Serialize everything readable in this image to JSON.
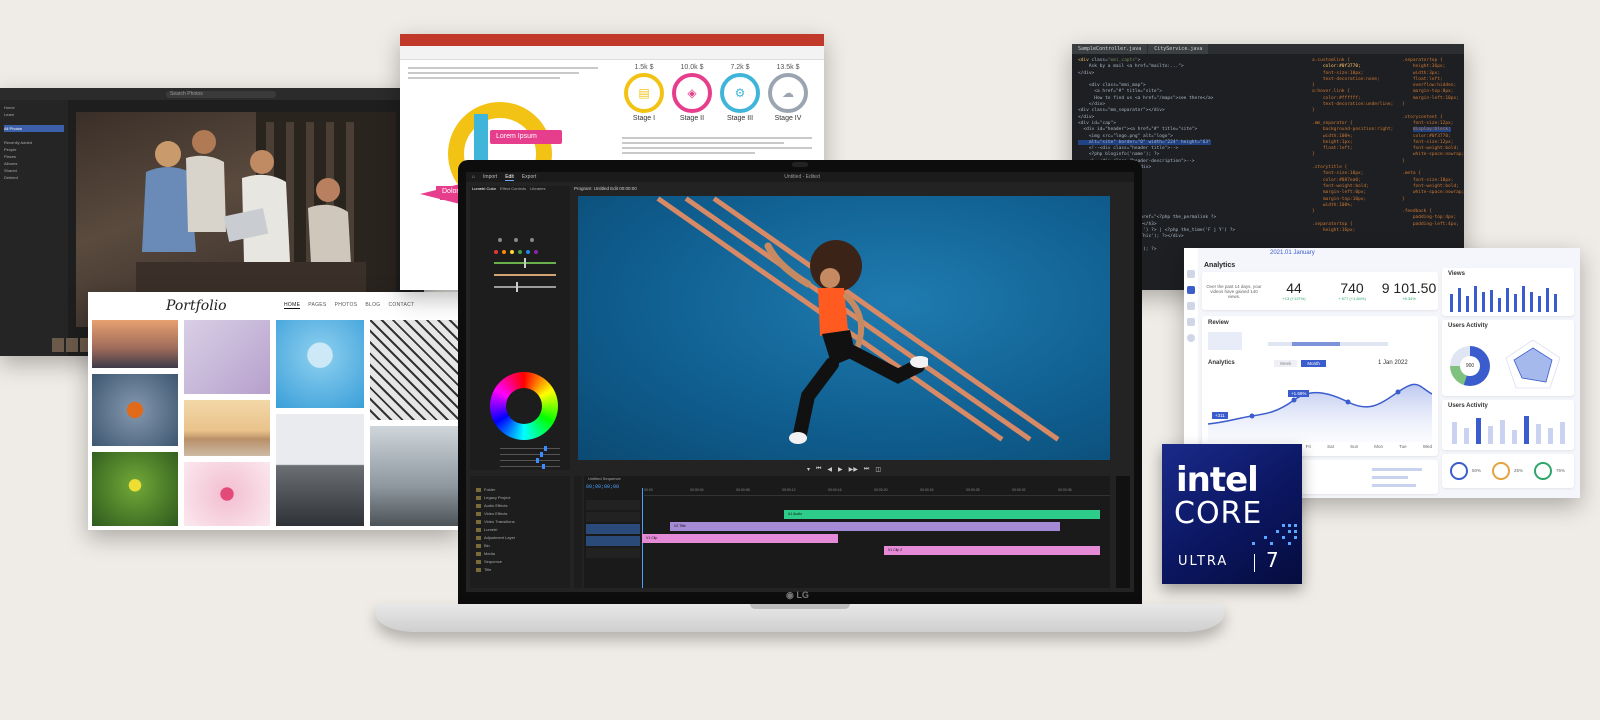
{
  "photo_editor": {
    "search_placeholder": "Search Photos",
    "nav_items": [
      "Home",
      "Learn",
      "",
      "All Photos",
      "",
      "Recently Added",
      "People",
      "Places",
      "Albums",
      "Shared",
      "Deleted"
    ],
    "active_index": 3
  },
  "portfolio": {
    "logo": "Portfolio",
    "nav": [
      "HOME",
      "PAGES",
      "PHOTOS",
      "BLOG",
      "CONTACT"
    ],
    "active_nav": "HOME"
  },
  "infographic": {
    "lorem_label": "Lorem Ipsum",
    "dolor_label": "Dolor",
    "stages": [
      {
        "amount": "1.5k $",
        "label": "Stage I",
        "color": "#f2c314",
        "icon": "document-icon"
      },
      {
        "amount": "10.0k $",
        "label": "Stage II",
        "color": "#e63e8c",
        "icon": "cube-icon"
      },
      {
        "amount": "7.2k $",
        "label": "Stage III",
        "color": "#3fb6d9",
        "icon": "gear-icon"
      },
      {
        "amount": "13.5k $",
        "label": "Stage IV",
        "color": "#9aa5b1",
        "icon": "cloud-icon"
      }
    ]
  },
  "code_editor": {
    "tabs": [
      "SampleController.java",
      "CityService.java"
    ]
  },
  "analytics": {
    "date": "2021.01 January",
    "title": "Analytics",
    "intro": "Over the past 14 days, your videos have gained 140 views.",
    "kpis": [
      {
        "value": "44",
        "sub": "+13 (+137%)"
      },
      {
        "value": "740",
        "sub": "+ 577 (+1.84%)"
      },
      {
        "value": "9 101.50",
        "sub": "+8.34%"
      }
    ],
    "views_title": "Views",
    "review_title": "Review",
    "users_activity_title": "Users Activity",
    "chart_title": "Analytics",
    "chart_date": "1 Jan 2022",
    "toggle": [
      "Week",
      "Month"
    ],
    "callouts": [
      "+311",
      "+1.68%"
    ],
    "days": [
      "Mon",
      "Tue",
      "Wed",
      "Thu",
      "Fri",
      "Sat",
      "Sun",
      "Mon",
      "Tue",
      "Wed"
    ],
    "donut_value": "900",
    "percents": [
      "50%",
      "25%",
      "76%"
    ]
  },
  "premiere": {
    "menu": [
      "Import",
      "Edit",
      "Export"
    ],
    "active_menu": "Edit",
    "center_title": "Untitled - Edited",
    "effects_tabs": [
      "Lumetri Color",
      "Effect Controls",
      "Libraries"
    ],
    "program_label": "Program: Untitled Edit  00:00:00",
    "timecode": "00;00;00;00",
    "sequence_label": "Untitled Sequence",
    "ruler_ticks": [
      "00:00",
      "00:00:04",
      "00:00:08",
      "00:00:12",
      "00:00:16",
      "00:00:20",
      "00:00:24",
      "00:00:28",
      "00:00:32",
      "00:00:36"
    ],
    "project_items": [
      "Folder",
      "Legacy Project",
      "Audio Effects",
      "Video Effects",
      "Video Transitions",
      "Lumetri",
      "Adjustment Layer",
      "Bin",
      "Media",
      "Sequence",
      "Title"
    ],
    "clips": [
      {
        "label": "A1 Audio",
        "color": "#2ecc8a"
      },
      {
        "label": "V2 Title",
        "color": "#a58ad6"
      },
      {
        "label": "V1 Clip",
        "color": "#e58ad6"
      },
      {
        "label": "V1 Clip 2",
        "color": "#e58ad6"
      }
    ]
  },
  "laptop": {
    "brand": "LG"
  },
  "intel_badge": {
    "brand": "intel",
    "line": "CORE",
    "tier": "ULTRA",
    "number": "7",
    "bg_color": "#0b1660"
  }
}
